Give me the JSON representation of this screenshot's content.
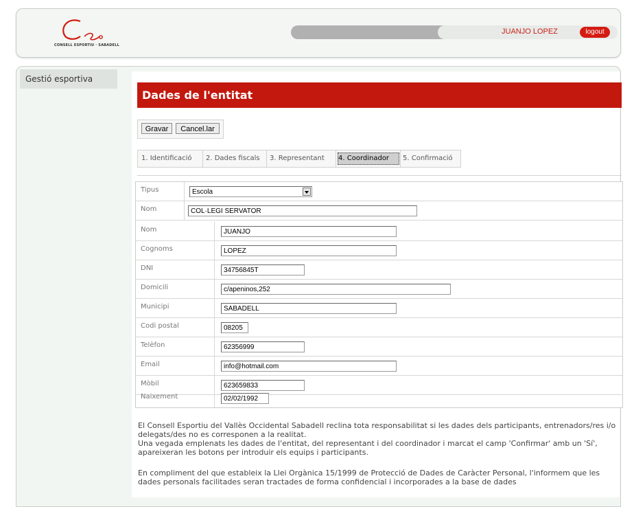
{
  "header": {
    "logo_text": "CONSELL ESPORTIU · SABADELL",
    "user_name": "JUANJO LOPEZ",
    "logout_label": "logout"
  },
  "sidebar": {
    "items": [
      {
        "label": "Gestió esportiva"
      }
    ]
  },
  "page": {
    "title": "Dades de l'entitat"
  },
  "toolbar": {
    "save_label": "Gravar",
    "cancel_label": "Cancel.lar"
  },
  "tabs": [
    {
      "label": "1. Identificació"
    },
    {
      "label": "2. Dades fiscals"
    },
    {
      "label": "3. Representant"
    },
    {
      "label": "4. Coordinador",
      "active": true
    },
    {
      "label": "5. Confirmació"
    }
  ],
  "form": {
    "tipus": {
      "label": "Tipus",
      "value": "Escola"
    },
    "entity_name": {
      "label": "Nom",
      "value": "COL·LEGI SERVATOR"
    },
    "fields": [
      {
        "label": "Nom",
        "value": "JUANJO"
      },
      {
        "label": "Cognoms",
        "value": "LOPEZ"
      },
      {
        "label": "DNI",
        "value": "34756845T"
      },
      {
        "label": "Domicili",
        "value": "c/apeninos,252"
      },
      {
        "label": "Municipi",
        "value": "SABADELL"
      },
      {
        "label": "Codi postal",
        "value": "08205"
      },
      {
        "label": "Telèfon",
        "value": "62356999"
      },
      {
        "label": "Email",
        "value": "info@hotmail.com"
      },
      {
        "label": "Mòbil",
        "value": "623659833"
      },
      {
        "label": "Naixement",
        "value": "02/02/1992"
      }
    ]
  },
  "notes": {
    "p1": "El Consell Esportiu del Vallès Occidental Sabadell reclina tota responsabilitat si les dades dels participants, entrenadors/res i/o delegats/des no es corresponen a la realitat.",
    "p2": "Una vegada emplenats les dades de l'entitat, del representant i del coordinador i marcat el camp 'Confirmar' amb un 'Sí', apareixeran les botons per introduir els equips i participants.",
    "p3": "En compliment del que estableix la Llei Orgànica 15/1999 de Protecció de Dades de Caràcter Personal, l'informem que les dades personals facilitades seran tractades de forma confidencial i incorporades a la base de dades"
  },
  "colors": {
    "accent": "#c3180e",
    "topbar": "#b1b1b1"
  }
}
